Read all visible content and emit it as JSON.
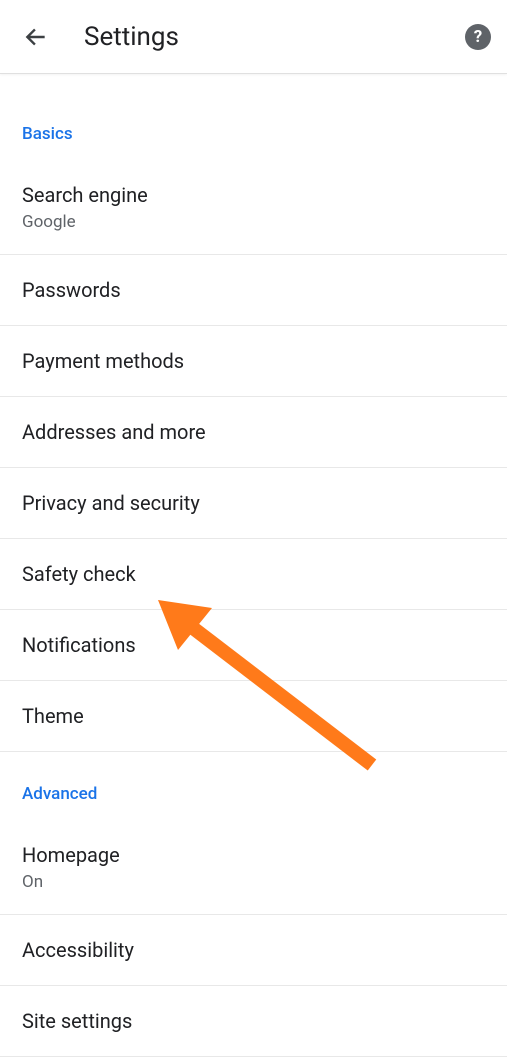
{
  "header": {
    "title": "Settings"
  },
  "sections": {
    "basics": {
      "label": "Basics",
      "items": [
        {
          "title": "Search engine",
          "sub": "Google"
        },
        {
          "title": "Passwords"
        },
        {
          "title": "Payment methods"
        },
        {
          "title": "Addresses and more"
        },
        {
          "title": "Privacy and security"
        },
        {
          "title": "Safety check"
        },
        {
          "title": "Notifications"
        },
        {
          "title": "Theme"
        }
      ]
    },
    "advanced": {
      "label": "Advanced",
      "items": [
        {
          "title": "Homepage",
          "sub": "On"
        },
        {
          "title": "Accessibility"
        },
        {
          "title": "Site settings"
        }
      ]
    }
  }
}
